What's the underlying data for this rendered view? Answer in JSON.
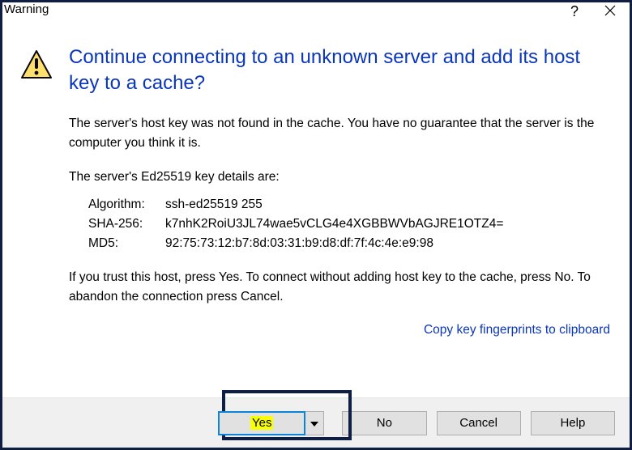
{
  "titlebar": {
    "title": "Warning",
    "help_glyph": "?"
  },
  "heading": "Continue connecting to an unknown server and add its host key to a cache?",
  "paragraphs": {
    "p1": "The server's host key was not found in the cache. You have no guarantee that the server is the computer you think it is.",
    "p2": "The server's Ed25519 key details are:",
    "p3": "If you trust this host, press Yes. To connect without adding host key to the cache, press No. To abandon the connection press Cancel."
  },
  "key_details": {
    "rows": [
      {
        "label": "Algorithm:",
        "value": "ssh-ed25519 255"
      },
      {
        "label": "SHA-256:",
        "value": "k7nhK2RoiU3JL74wae5vCLG4e4XGBBWVbAGJRE1OTZ4="
      },
      {
        "label": "MD5:",
        "value": "92:75:73:12:b7:8d:03:31:b9:d8:df:7f:4c:4e:e9:98"
      }
    ]
  },
  "links": {
    "copy_fingerprints": "Copy key fingerprints to clipboard"
  },
  "buttons": {
    "yes": "Yes",
    "no": "No",
    "cancel": "Cancel",
    "help": "Help"
  },
  "icons": {
    "warning": "warning-triangle-icon",
    "close": "close-icon",
    "titlebar_help": "help-icon",
    "chevron_down": "chevron-down-icon"
  }
}
